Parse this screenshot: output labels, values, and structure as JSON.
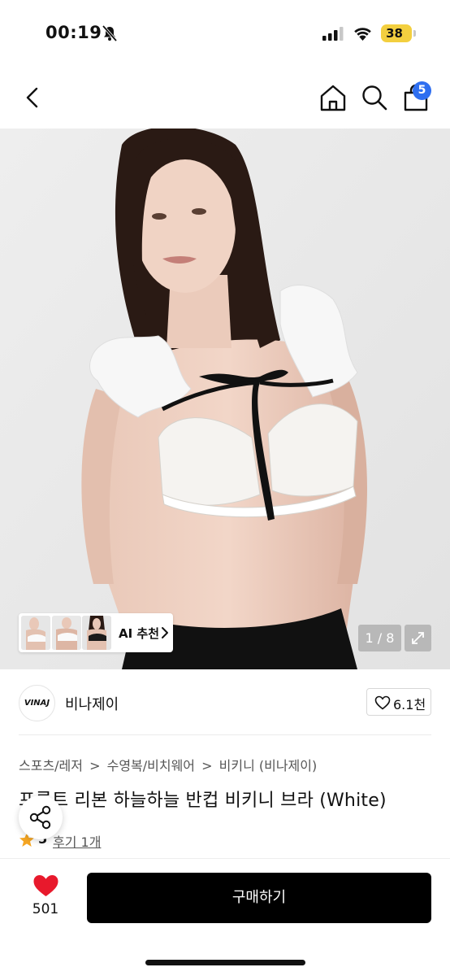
{
  "status_bar": {
    "time": "00:19",
    "battery": "38",
    "icons": [
      "bell-slash-icon",
      "signal-icon",
      "wifi-icon",
      "battery-icon"
    ],
    "battery_color": "#f3cf3f"
  },
  "nav": {
    "icons": [
      "chevron-left-icon",
      "home-icon",
      "search-icon",
      "shopping-bag-icon"
    ],
    "cart_badge": "5",
    "badge_color": "#2f6ff0"
  },
  "gallery": {
    "ai_label": "AI 추천",
    "counter": "1 / 8",
    "thumbnail_count": 3,
    "expand_icon": "expand-icon"
  },
  "brand": {
    "logo_text": "VINAJ",
    "name": "비나제이",
    "likes": "6.1천"
  },
  "product": {
    "breadcrumb": [
      "스포츠/레저",
      "수영복/비치웨어",
      "비키니 (비나제이)"
    ],
    "breadcrumb_sep": ">",
    "title": "프론트 리본 하늘하늘 반컵 비키니 브라 (White)",
    "rating": "5",
    "review_text": "후기 1개",
    "star_color": "#f5a623"
  },
  "bottom": {
    "wish_count": "501",
    "buy_label": "구매하기",
    "heart_color": "#e8192c"
  }
}
